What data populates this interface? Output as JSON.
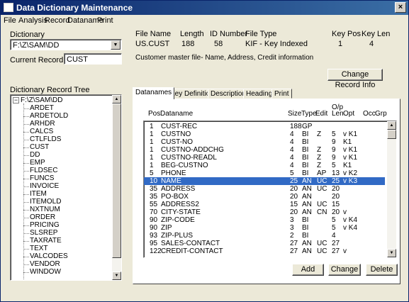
{
  "window": {
    "title": "Data Dictionary Maintenance",
    "close_glyph": "×"
  },
  "menu": [
    "File",
    "Analysis",
    "Record",
    "Dataname",
    "Print"
  ],
  "dictionary": {
    "label": "Dictionary",
    "value": "F:\\Z\\SAM\\DD"
  },
  "current_record": {
    "label": "Current Record Name",
    "value": "CUST"
  },
  "file_info": {
    "headers": {
      "file_name": "File Name",
      "length": "Length",
      "id_number": "ID Number",
      "file_type": "File Type",
      "key_pos": "Key Pos",
      "key_len": "Key Len"
    },
    "values": {
      "file_name": "US.CUST",
      "length": "188",
      "id_number": "58",
      "file_type": "KIF - Key Indexed",
      "key_pos": "1",
      "key_len": "4"
    },
    "description": "Customer master file- Name, Address, Credit information"
  },
  "change_record_button": "Change Record Info",
  "tree": {
    "label": "Dictionary Record Tree",
    "root": "F:\\Z\\SAM\\DD",
    "items": [
      "ARDET",
      "ARDETOLD",
      "ARHDR",
      "CALCS",
      "CTLFLDS",
      "CUST",
      "DD",
      "EMP",
      "FLDSEC",
      "FUNCS",
      "INVOICE",
      "ITEM",
      "ITEMOLD",
      "NXTNUM",
      "ORDER",
      "PRICING",
      "SLSREP",
      "TAXRATE",
      "TEXT",
      "VALCODES",
      "VENDOR",
      "WINDOW"
    ]
  },
  "tabs": [
    "Datanames",
    "Key Definitions",
    "Descriptions",
    "Headings",
    "Print"
  ],
  "grid": {
    "headers": {
      "pos": "Pos",
      "dataname": "Dataname",
      "size": "Size",
      "type": "Type",
      "edit": "Edit",
      "op_len_top": "O/p",
      "op_len_bottom": "Len",
      "opt": "Opt",
      "occ": "Occ",
      "grp": "Grp"
    },
    "rows": [
      {
        "pos": "1",
        "name": "CUST-REC",
        "size": "188",
        "type": "GP",
        "edit": "",
        "oplen": "",
        "opt": ""
      },
      {
        "pos": "1",
        "name": "CUSTNO",
        "size": "4",
        "type": "BI",
        "edit": "Z",
        "oplen": "5",
        "opt": "v K1"
      },
      {
        "pos": "1",
        "name": "CUST-NO",
        "size": "4",
        "type": "BI",
        "edit": "",
        "oplen": "9",
        "opt": "K1"
      },
      {
        "pos": "1",
        "name": "CUSTNO-ADDCHG",
        "size": "4",
        "type": "BI",
        "edit": "Z",
        "oplen": "9",
        "opt": "v K1"
      },
      {
        "pos": "1",
        "name": "CUSTNO-READL",
        "size": "4",
        "type": "BI",
        "edit": "Z",
        "oplen": "9",
        "opt": "v K1"
      },
      {
        "pos": "1",
        "name": "BEG-CUSTNO",
        "size": "4",
        "type": "BI",
        "edit": "Z",
        "oplen": "5",
        "opt": "K1"
      },
      {
        "pos": "5",
        "name": "PHONE",
        "size": "5",
        "type": "BI",
        "edit": "AP",
        "oplen": "13",
        "opt": "v K2"
      },
      {
        "pos": "10",
        "name": "NAME",
        "size": "25",
        "type": "AN",
        "edit": "UC",
        "oplen": "25",
        "opt": "v K3",
        "selected": true
      },
      {
        "pos": "35",
        "name": "ADDRESS",
        "size": "20",
        "type": "AN",
        "edit": "UC",
        "oplen": "20",
        "opt": ""
      },
      {
        "pos": "35",
        "name": "PO-BOX",
        "size": "20",
        "type": "AN",
        "edit": "",
        "oplen": "20",
        "opt": ""
      },
      {
        "pos": "55",
        "name": "ADDRESS2",
        "size": "15",
        "type": "AN",
        "edit": "UC",
        "oplen": "15",
        "opt": ""
      },
      {
        "pos": "70",
        "name": "CITY-STATE",
        "size": "20",
        "type": "AN",
        "edit": "CN",
        "oplen": "20",
        "opt": "v"
      },
      {
        "pos": "90",
        "name": "ZIP-CODE",
        "size": "3",
        "type": "BI",
        "edit": "",
        "oplen": "5",
        "opt": "v K4"
      },
      {
        "pos": "90",
        "name": "ZIP",
        "size": "3",
        "type": "BI",
        "edit": "",
        "oplen": "5",
        "opt": "v K4"
      },
      {
        "pos": "93",
        "name": "ZIP-PLUS",
        "size": "2",
        "type": "BI",
        "edit": "",
        "oplen": "4",
        "opt": ""
      },
      {
        "pos": "95",
        "name": "SALES-CONTACT",
        "size": "27",
        "type": "AN",
        "edit": "UC",
        "oplen": "27",
        "opt": ""
      },
      {
        "pos": "122",
        "name": "CREDIT-CONTACT",
        "size": "27",
        "type": "AN",
        "edit": "UC",
        "oplen": "27",
        "opt": "v"
      }
    ]
  },
  "buttons": {
    "add": "Add",
    "change": "Change",
    "delete": "Delete"
  },
  "colors": {
    "title_bar": "#0a246a",
    "selection": "#316ac5",
    "face": "#ece9d8"
  }
}
